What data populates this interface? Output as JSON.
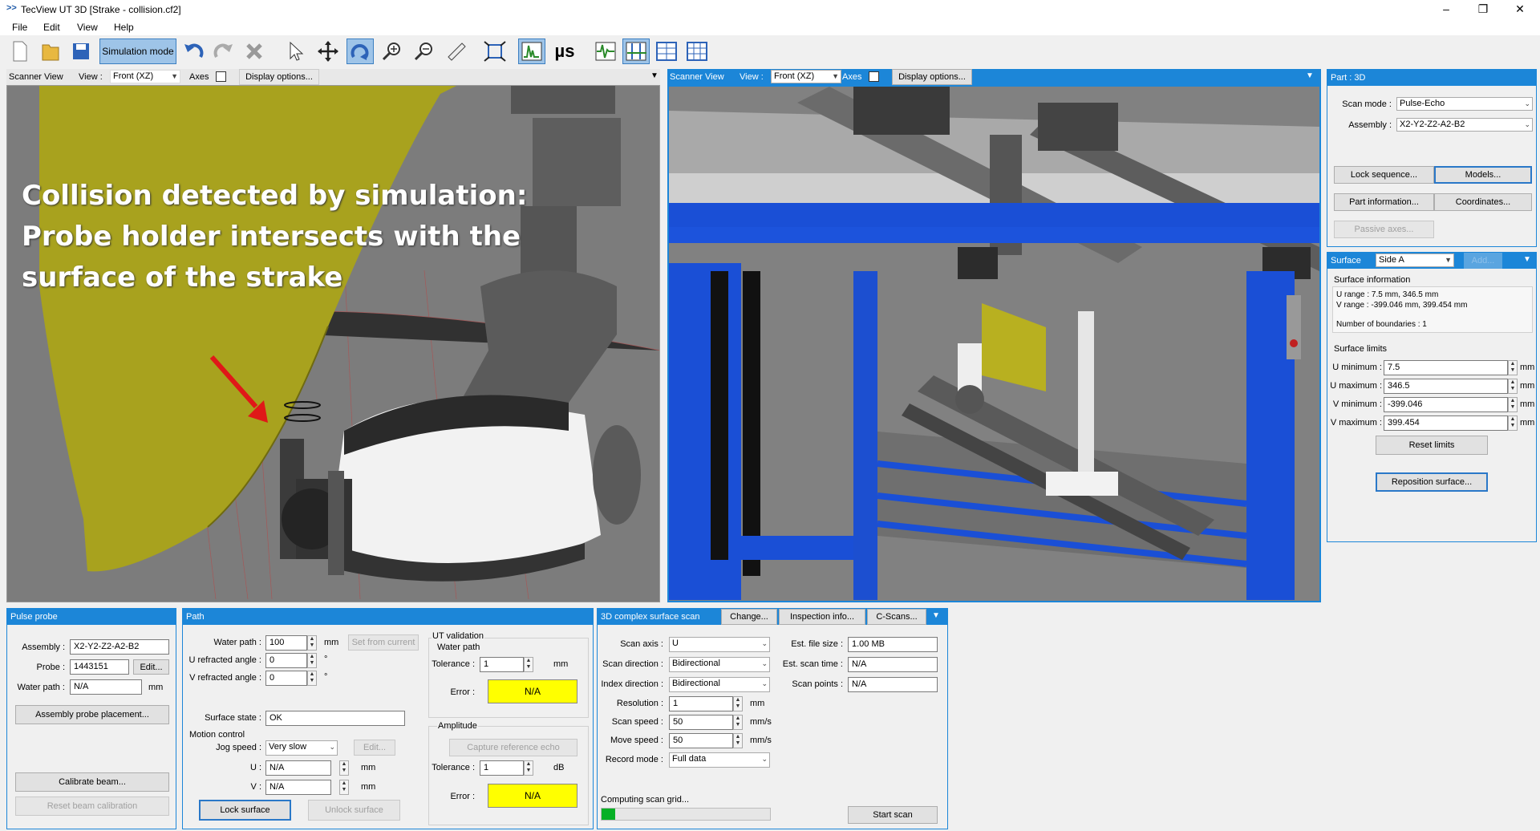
{
  "window": {
    "title": "TecView UT 3D [Strake - collision.cf2]",
    "minimize": "–",
    "maximize": "❐",
    "close": "✕"
  },
  "menu": [
    "File",
    "Edit",
    "View",
    "Help"
  ],
  "toolbar": {
    "simulation_mode": "Simulation mode",
    "mu_s": "µs"
  },
  "scanner_view_left": {
    "title": "Scanner View",
    "view_label": "View :",
    "view_value": "Front  (XZ)",
    "axes_label": "Axes",
    "display_options": "Display options...",
    "overlay": [
      "Collision detected by simulation:",
      "Probe holder intersects with the",
      "surface of the strake"
    ]
  },
  "scanner_view_right": {
    "title": "Scanner View",
    "view_label": "View :",
    "view_value": "Front  (XZ)",
    "axes_label": "Axes",
    "display_options": "Display options..."
  },
  "part3d": {
    "title": "Part : 3D",
    "scan_mode_label": "Scan mode :",
    "scan_mode_value": "Pulse-Echo",
    "assembly_label": "Assembly :",
    "assembly_value": "X2-Y2-Z2-A2-B2",
    "lock_sequence": "Lock sequence...",
    "models": "Models...",
    "part_information": "Part information...",
    "coordinates": "Coordinates...",
    "passive_axes": "Passive axes..."
  },
  "surface": {
    "title": "Surface",
    "side_value": "Side A",
    "add": "Add...",
    "info_title": "Surface information",
    "u_range": "U range : 7.5 mm, 346.5 mm",
    "v_range": "V range : -399.046 mm, 399.454 mm",
    "boundaries": "Number of boundaries : 1",
    "limits_title": "Surface limits",
    "u_min_label": "U minimum :",
    "u_min": "7.5",
    "u_max_label": "U maximum :",
    "u_max": "346.5",
    "v_min_label": "V minimum :",
    "v_min": "-399.046",
    "v_max_label": "V maximum :",
    "v_max": "399.454",
    "unit": "mm",
    "reset_limits": "Reset limits",
    "reposition": "Reposition surface..."
  },
  "pulse_probe": {
    "title": "Pulse probe",
    "assembly_label": "Assembly :",
    "assembly_value": "X2-Y2-Z2-A2-B2",
    "probe_label": "Probe :",
    "probe_value": "1443151",
    "edit": "Edit...",
    "water_path_label": "Water path :",
    "water_path_value": "N/A",
    "unit": "mm",
    "assembly_probe_placement": "Assembly probe placement...",
    "calibrate_beam": "Calibrate beam...",
    "reset_beam": "Reset beam calibration"
  },
  "path": {
    "title": "Path",
    "water_path_label": "Water path :",
    "water_path_value": "100",
    "mm": "mm",
    "set_from_current": "Set from current",
    "u_refr_label": "U refracted angle :",
    "u_refr_value": "0",
    "v_refr_label": "V refracted angle :",
    "v_refr_value": "0",
    "deg": "°",
    "surface_state_label": "Surface state :",
    "surface_state_value": "OK",
    "motion_control": "Motion control",
    "jog_speed_label": "Jog speed :",
    "jog_speed_value": "Very slow",
    "edit": "Edit...",
    "u_label": "U :",
    "u_value": "N/A",
    "v_label": "V :",
    "v_value": "N/A",
    "lock_surface": "Lock surface",
    "unlock_surface": "Unlock surface",
    "ut_validation": "UT validation",
    "water_path_sub": "Water path",
    "tolerance_label": "Tolerance :",
    "tolerance_value": "1",
    "error_label": "Error :",
    "error_value": "N/A",
    "amplitude": "Amplitude",
    "capture_reference": "Capture reference echo",
    "amp_tolerance_value": "1",
    "db": "dB",
    "amp_error_value": "N/A"
  },
  "scan": {
    "title": "3D complex surface scan",
    "change": "Change...",
    "inspection_info": "Inspection info...",
    "cscans": "C-Scans...",
    "scan_axis_label": "Scan axis :",
    "scan_axis_value": "U",
    "scan_direction_label": "Scan direction :",
    "scan_direction_value": "Bidirectional",
    "index_direction_label": "Index direction :",
    "index_direction_value": "Bidirectional",
    "resolution_label": "Resolution :",
    "resolution_value": "1",
    "mm": "mm",
    "scan_speed_label": "Scan speed :",
    "scan_speed_value": "50",
    "mms": "mm/s",
    "move_speed_label": "Move speed :",
    "move_speed_value": "50",
    "record_mode_label": "Record mode :",
    "record_mode_value": "Full data",
    "file_size_label": "Est. file size :",
    "file_size_value": "1.00 MB",
    "scan_time_label": "Est. scan time :",
    "scan_time_value": "N/A",
    "scan_points_label": "Scan points :",
    "scan_points_value": "N/A",
    "computing": "Computing scan grid...",
    "progress": 0.08,
    "start_scan": "Start scan"
  }
}
